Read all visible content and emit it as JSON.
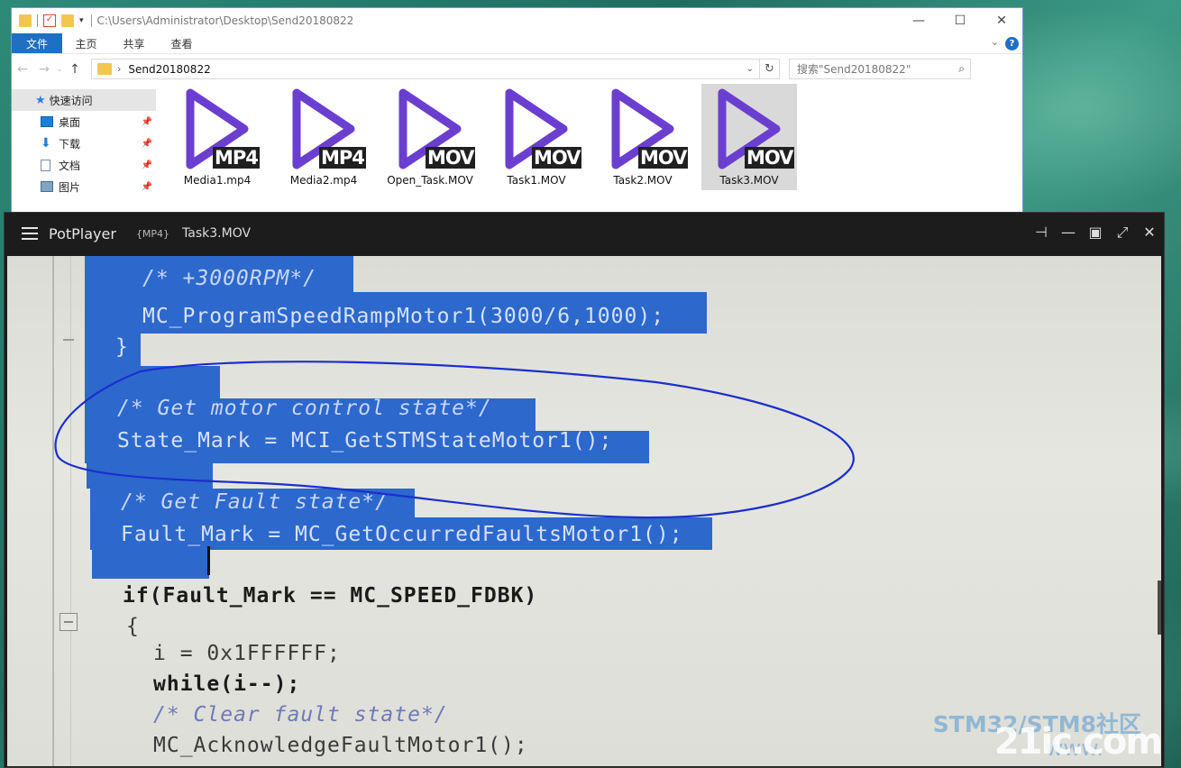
{
  "explorer": {
    "title_path": "C:\\Users\\Administrator\\Desktop\\Send20180822",
    "ribbon_tabs": [
      "文件",
      "主页",
      "共享",
      "查看"
    ],
    "address_folder": "Send20180822",
    "search_placeholder": "搜索\"Send20180822\"",
    "nav_items": [
      "快速访问",
      "桌面",
      "下载",
      "文档",
      "图片"
    ],
    "files": [
      {
        "name": "Media1.mp4",
        "badge": "MP4"
      },
      {
        "name": "Media2.mp4",
        "badge": "MP4"
      },
      {
        "name": "Open_Task.MOV",
        "badge": "MOV"
      },
      {
        "name": "Task1.MOV",
        "badge": "MOV"
      },
      {
        "name": "Task2.MOV",
        "badge": "MOV"
      },
      {
        "name": "Task3.MOV",
        "badge": "MOV"
      }
    ],
    "selected_file": "Task3.MOV",
    "icon_color": "#6a3fd0"
  },
  "potplayer": {
    "app_name": "PotPlayer",
    "format": "{MP4}",
    "file": "Task3.MOV",
    "code_lines": [
      "/* +3000RPM*/",
      "MC_ProgramSpeedRampMotor1(3000/6,1000);",
      "}",
      "/* Get motor control state*/",
      "State_Mark = MCI_GetSTMStateMotor1();",
      "/* Get Fault state*/",
      "Fault_Mark = MC_GetOccurredFaultsMotor1();",
      "if(Fault_Mark == MC_SPEED_FDBK)",
      "{",
      "i = 0x1FFFFFF;",
      "while(i--);",
      "/* Clear fault state*/",
      "MC_AcknowledgeFaultMotor1();"
    ],
    "selection_color": "#2d68cc",
    "annotation_color": "#1a2fd0"
  },
  "watermark": {
    "line1": "STM32/STM8社区",
    "line2": "www.",
    "brand": "21ic.com"
  }
}
